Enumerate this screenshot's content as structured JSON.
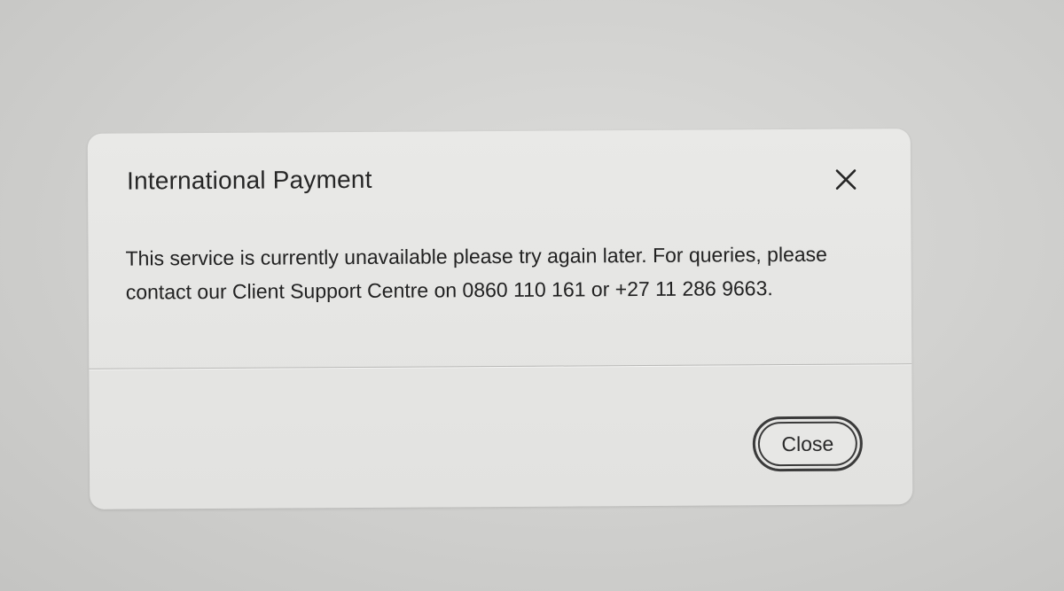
{
  "dialog": {
    "title": "International Payment",
    "close_icon": "close-icon",
    "message": "This service is currently unavailable please try again later. For queries, please contact our Client Support Centre on 0860 110 161 or +27 11 286 9663.",
    "close_button_label": "Close"
  },
  "colors": {
    "dialog_background": "#e7e7e5",
    "text": "#222222",
    "button_border": "#3a3a3a"
  }
}
